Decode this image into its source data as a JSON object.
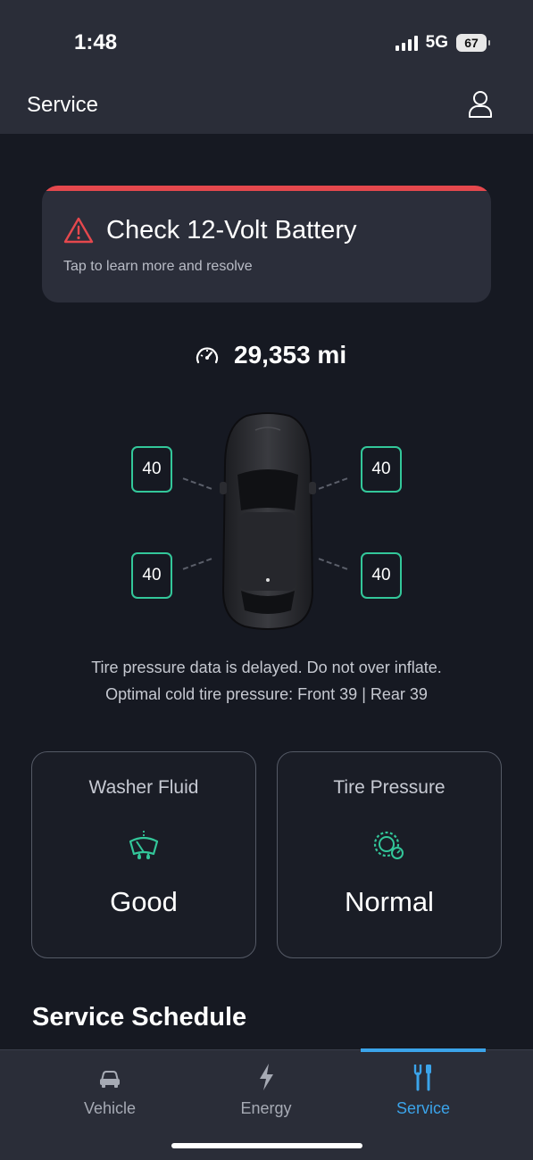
{
  "status_bar": {
    "time": "1:48",
    "network": "5G",
    "battery": "67",
    "icons": [
      "signal-icon",
      "battery-icon"
    ]
  },
  "header": {
    "title": "Service",
    "profile_icon": "profile-icon"
  },
  "alert": {
    "title": "Check 12-Volt Battery",
    "subtitle": "Tap to learn more and resolve",
    "icon": "warning-icon",
    "accent_color": "#e5484d"
  },
  "odometer": {
    "icon": "speedometer-icon",
    "value": "29,353 mi"
  },
  "tires": {
    "front_left": "40",
    "front_right": "40",
    "rear_left": "40",
    "rear_right": "40",
    "border_color": "#33c79a"
  },
  "tire_notes": {
    "line1": "Tire pressure data is delayed. Do not over inflate.",
    "line2": "Optimal cold tire pressure: Front 39 | Rear 39"
  },
  "status_cards": [
    {
      "label": "Washer Fluid",
      "value": "Good",
      "icon": "washer-fluid-icon"
    },
    {
      "label": "Tire Pressure",
      "value": "Normal",
      "icon": "tire-pressure-icon"
    }
  ],
  "section": {
    "title": "Service Schedule"
  },
  "nav": {
    "items": [
      {
        "label": "Vehicle",
        "icon": "car-icon"
      },
      {
        "label": "Energy",
        "icon": "lightning-icon"
      },
      {
        "label": "Service",
        "icon": "tools-icon"
      }
    ],
    "active_index": 2,
    "active_color": "#3ba4ea"
  }
}
